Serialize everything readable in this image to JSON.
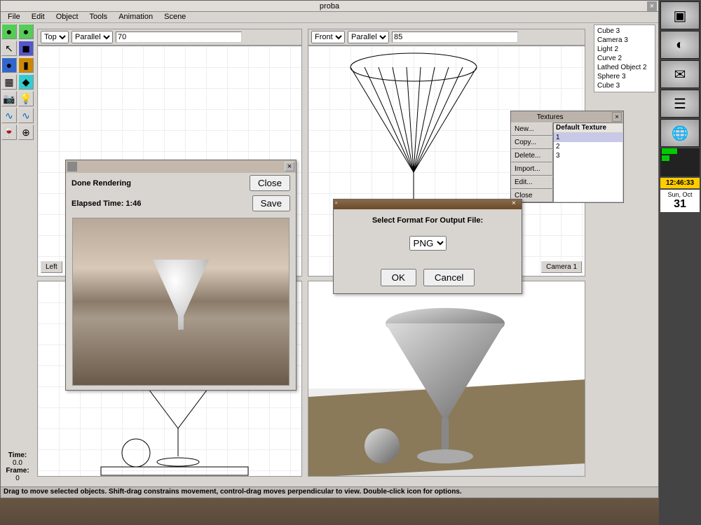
{
  "window": {
    "title": "proba"
  },
  "menubar": [
    "File",
    "Edit",
    "Object",
    "Tools",
    "Animation",
    "Scene"
  ],
  "viewports": {
    "top_left": {
      "view": "Top",
      "proj": "Parallel",
      "val": "70",
      "label": "Left"
    },
    "top_right": {
      "view": "Front",
      "proj": "Parallel",
      "val": "85",
      "label": "Camera 1"
    }
  },
  "scene_objects": [
    "Cube 3",
    "Camera 3",
    "Light 2",
    "Curve 2",
    "Lathed Object 2",
    "Sphere 3",
    "Cube 3"
  ],
  "time_info": {
    "time_label": "Time:",
    "time_val": "0.0",
    "frame_label": "Frame:",
    "frame_val": "0"
  },
  "statusbar": "Drag to move selected objects.  Shift-drag constrains movement, control-drag moves perpendicular to view.  Double-click icon for options.",
  "render_dialog": {
    "done": "Done Rendering",
    "close": "Close",
    "elapsed": "Elapsed Time: 1:46",
    "save": "Save"
  },
  "format_dialog": {
    "title": "Select Format For Output File:",
    "format": "PNG",
    "ok": "OK",
    "cancel": "Cancel"
  },
  "textures_dialog": {
    "title": "Textures",
    "buttons": [
      "New...",
      "Copy...",
      "Delete...",
      "Import...",
      "Edit...",
      "Close"
    ],
    "header": "Default Texture",
    "items": [
      "1",
      "2",
      "3"
    ]
  },
  "desktop": {
    "clock": "12:46:33",
    "date_day": "Sun, Oct",
    "date_num": "31"
  }
}
